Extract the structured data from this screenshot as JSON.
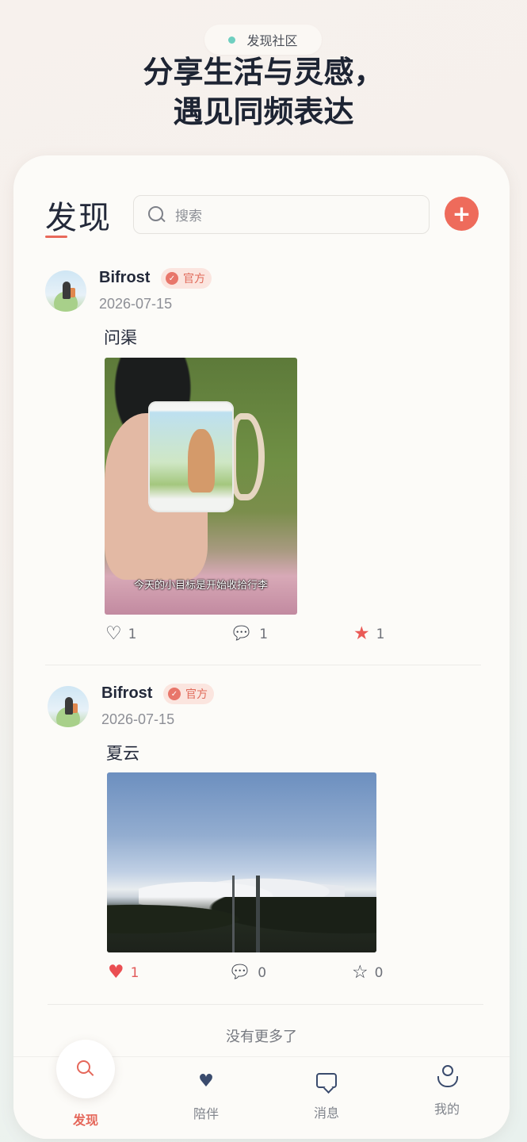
{
  "header": {
    "pill_label": "发现社区",
    "headline_line1": "分享生活与灵感，",
    "headline_line2": "遇见同频表达"
  },
  "page": {
    "title": "发现",
    "search_placeholder": "搜索",
    "add_button": "+"
  },
  "posts": [
    {
      "username": "Bifrost",
      "badge": "官方",
      "date": "2026-07-15",
      "text": "问渠",
      "image_caption": "今天的小目标是开始收拾行李",
      "likes": "1",
      "liked": false,
      "comments": "1",
      "stars": "1",
      "starred": true
    },
    {
      "username": "Bifrost",
      "badge": "官方",
      "date": "2026-07-15",
      "text": "夏云",
      "likes": "1",
      "liked": true,
      "comments": "0",
      "stars": "0",
      "starred": false
    }
  ],
  "feed_end": "没有更多了",
  "tabbar": {
    "items": [
      {
        "label": "发现",
        "icon": "search-icon",
        "active": true
      },
      {
        "label": "陪伴",
        "icon": "heart-icon",
        "active": false
      },
      {
        "label": "消息",
        "icon": "message-icon",
        "active": false
      },
      {
        "label": "我的",
        "icon": "profile-icon",
        "active": false
      }
    ]
  },
  "colors": {
    "accent": "#ee6b5b",
    "pill_dot": "#6fcfc0",
    "text_dark": "#23293a",
    "like_red": "#ea4e52"
  }
}
